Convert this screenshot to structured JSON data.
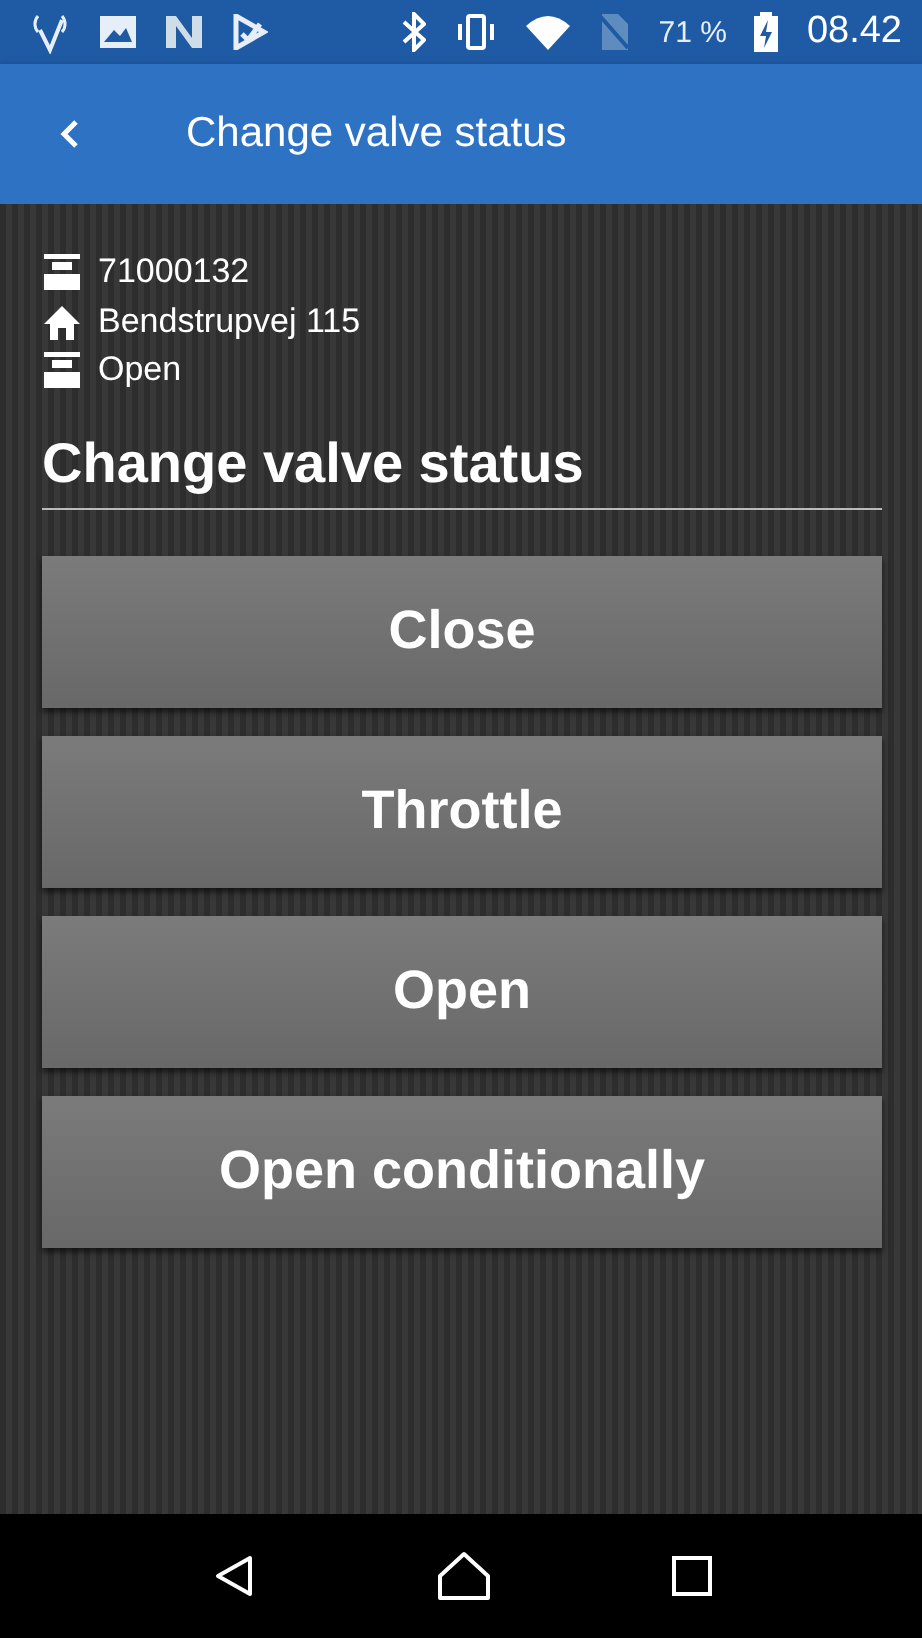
{
  "status_bar": {
    "battery": "71 %",
    "time": "08.42"
  },
  "app_bar": {
    "title": "Change valve status"
  },
  "info": [
    {
      "kind": "valve",
      "text": "71000132"
    },
    {
      "kind": "home",
      "text": "Bendstrupvej 115"
    },
    {
      "kind": "valve",
      "text": "Open"
    }
  ],
  "section_title": "Change valve status",
  "buttons": [
    "Close",
    "Throttle",
    "Open",
    "Open conditionally"
  ]
}
